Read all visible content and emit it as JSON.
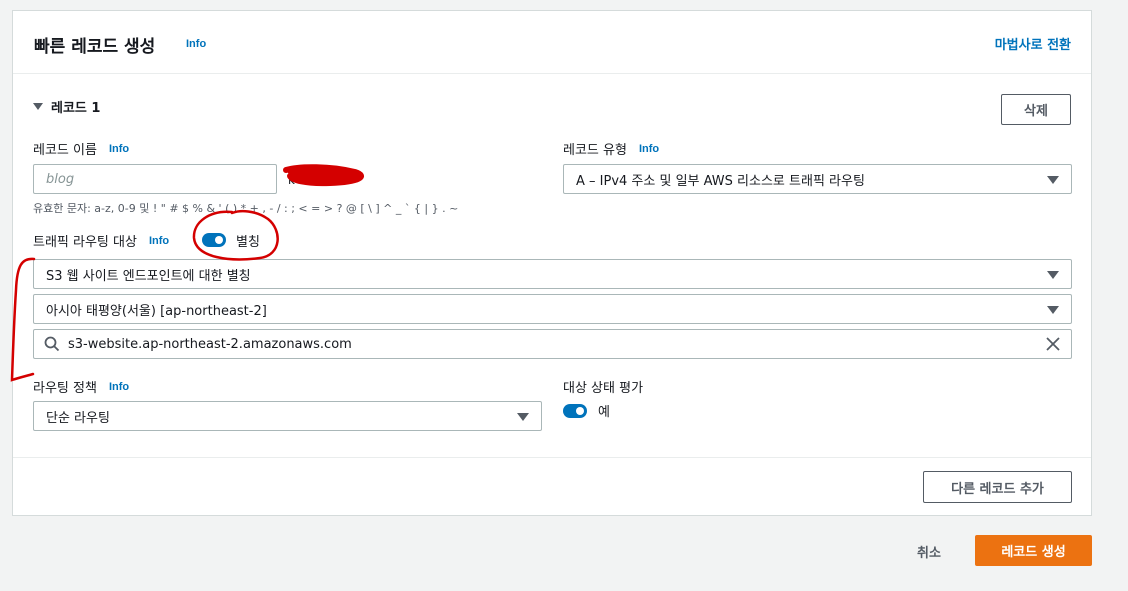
{
  "header": {
    "title": "빠른 레코드 생성",
    "info": "Info",
    "wizard_link": "마법사로 전환"
  },
  "record": {
    "heading": "레코드 1",
    "delete_label": "삭제",
    "name_label": "레코드 이름",
    "name_info": "Info",
    "name_placeholder": "blog",
    "name_suffix": "k",
    "name_hint": "유효한 문자: a-z, 0-9 및 ! \" # $ % & ' ( ) * + , - / : ; < = > ? @ [ \\ ] ^ _ ` { | } . ~",
    "type_label": "레코드 유형",
    "type_info": "Info",
    "type_value": "A – IPv4 주소 및 일부 AWS 리소스로 트래픽 라우팅",
    "target_label": "트래픽 라우팅 대상",
    "target_info": "Info",
    "alias_toggle_label": "별칭",
    "alias_target_type": "S3 웹 사이트 엔드포인트에 대한 별칭",
    "region": "아시아 태평양(서울) [ap-northeast-2]",
    "endpoint_search": "s3-website.ap-northeast-2.amazonaws.com",
    "policy_label": "라우팅 정책",
    "policy_info": "Info",
    "policy_value": "단순 라우팅",
    "health_label": "대상 상태 평가",
    "health_value": "예"
  },
  "actions": {
    "add_record": "다른 레코드 추가",
    "cancel": "취소",
    "create": "레코드 생성"
  },
  "colors": {
    "accent": "#0073bb",
    "primary": "#ec7211",
    "annotation": "#d40000"
  }
}
